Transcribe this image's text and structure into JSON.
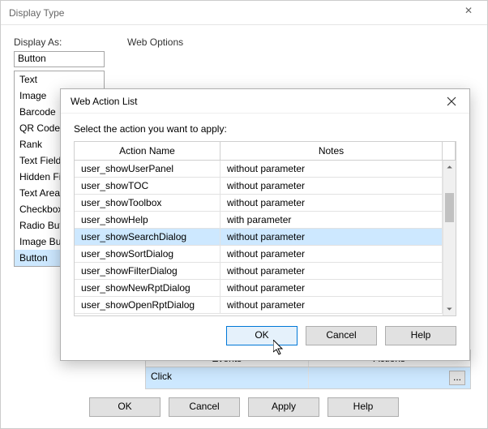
{
  "window": {
    "title": "Display Type",
    "labels": {
      "display_as": "Display As:",
      "web_options": "Web Options"
    },
    "display_as_value": "Button",
    "type_list": [
      "Text",
      "Image",
      "Barcode",
      "QR Code",
      "Rank",
      "Text Field",
      "Hidden Field",
      "Text Area",
      "Checkbox",
      "Radio Button",
      "Image Button",
      "Button"
    ],
    "type_selected": "Button",
    "events": {
      "headers": {
        "events": "Events",
        "actions": "Actions"
      },
      "row": {
        "event": "Click",
        "action": ""
      },
      "ellipsis": "..."
    },
    "buttons": {
      "ok": "OK",
      "cancel": "Cancel",
      "apply": "Apply",
      "help": "Help"
    }
  },
  "modal": {
    "title": "Web Action List",
    "instruction": "Select the action you want to apply:",
    "headers": {
      "action": "Action Name",
      "notes": "Notes"
    },
    "rows": [
      {
        "action": "user_showUserPanel",
        "notes": "without parameter"
      },
      {
        "action": "user_showTOC",
        "notes": "without parameter"
      },
      {
        "action": "user_showToolbox",
        "notes": "without parameter"
      },
      {
        "action": "user_showHelp",
        "notes": "with parameter"
      },
      {
        "action": "user_showSearchDialog",
        "notes": "without parameter"
      },
      {
        "action": "user_showSortDialog",
        "notes": "without parameter"
      },
      {
        "action": "user_showFilterDialog",
        "notes": "without parameter"
      },
      {
        "action": "user_showNewRptDialog",
        "notes": "without parameter"
      },
      {
        "action": "user_showOpenRptDialog",
        "notes": "without parameter"
      }
    ],
    "selected_index": 4,
    "buttons": {
      "ok": "OK",
      "cancel": "Cancel",
      "help": "Help"
    }
  }
}
